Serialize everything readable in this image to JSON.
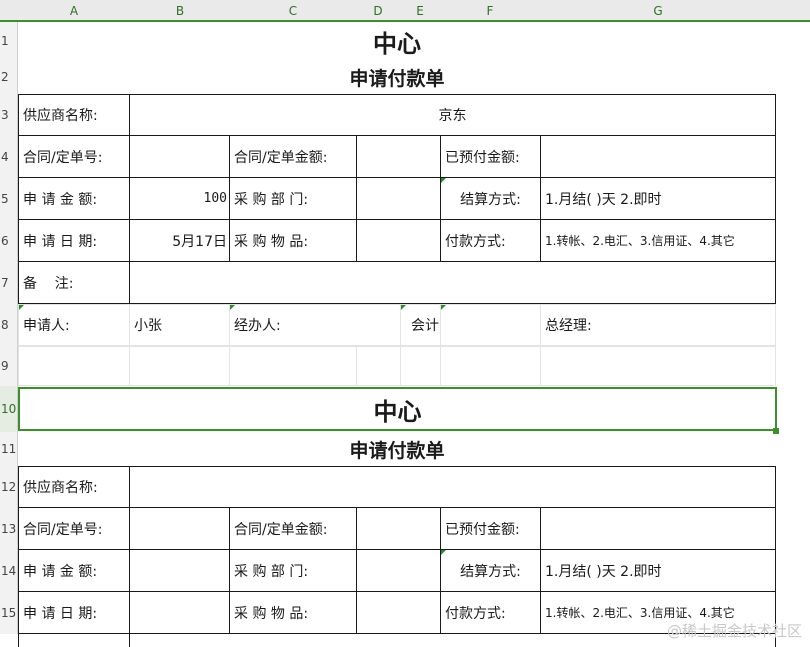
{
  "columns": [
    "A",
    "B",
    "C",
    "D",
    "E",
    "F",
    "G"
  ],
  "rows": [
    "1",
    "2",
    "3",
    "4",
    "5",
    "6",
    "7",
    "8",
    "9",
    "10",
    "11",
    "12",
    "13",
    "14",
    "15"
  ],
  "form1": {
    "title": "中心",
    "subtitle": "申请付款单",
    "supplier_label": "供应商名称:",
    "supplier_value": "京东",
    "contract_no_label": "合同/定单号:",
    "contract_amount_label": "合同/定单金额:",
    "prepaid_label": "已预付金额:",
    "apply_amount_label": "申 请 金 额:",
    "apply_amount_value": "100",
    "purchase_dept_label": "采 购 部 门:",
    "settle_label": "结算方式:",
    "settle_value": "1.月结(  )天  2.即时",
    "apply_date_label": "申 请 日 期:",
    "apply_date_value": "5月17日",
    "purchase_item_label": "采 购 物 品:",
    "pay_method_label": "付款方式:",
    "pay_method_value": "1.转帐、2.电汇、3.信用证、4.其它",
    "remark_label": "备    注:"
  },
  "signature_row": {
    "applicant_label": "申请人:",
    "applicant_value": "小张",
    "handler_label": "经办人:",
    "accountant_label": "会计",
    "gm_label": "总经理:"
  },
  "form2": {
    "title": "中心",
    "subtitle": "申请付款单",
    "supplier_label": "供应商名称:",
    "contract_no_label": "合同/定单号:",
    "contract_amount_label": "合同/定单金额:",
    "prepaid_label": "已预付金额:",
    "apply_amount_label": "申 请 金 额:",
    "purchase_dept_label": "采 购 部 门:",
    "settle_label": "结算方式:",
    "settle_value": "1.月结(  )天  2.即时",
    "apply_date_label": "申 请 日 期:",
    "purchase_item_label": "采 购 物 品:",
    "pay_method_label": "付款方式:",
    "pay_method_value": "1.转帐、2.电汇、3.信用证、4.其它"
  },
  "watermark": "@稀土掘金技术社区",
  "colors": {
    "accent": "#3f8e2e",
    "header_bg": "#eaeaea"
  }
}
